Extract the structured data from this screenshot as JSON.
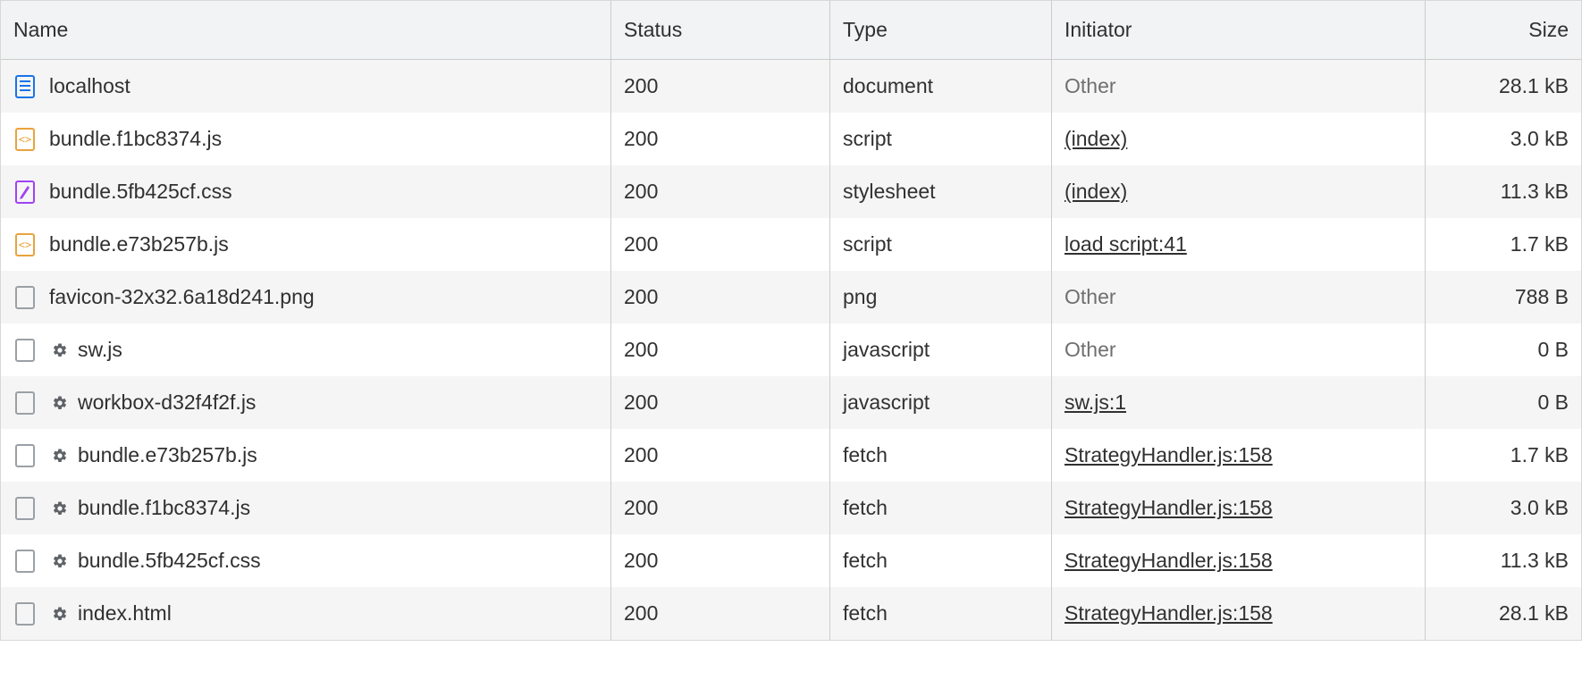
{
  "headers": {
    "name": "Name",
    "status": "Status",
    "type": "Type",
    "initiator": "Initiator",
    "size": "Size"
  },
  "rows": [
    {
      "icon": "document",
      "gear": false,
      "name": "localhost",
      "status": "200",
      "type": "document",
      "initiator": "Other",
      "initiator_link": false,
      "size": "28.1 kB"
    },
    {
      "icon": "script",
      "gear": false,
      "name": "bundle.f1bc8374.js",
      "status": "200",
      "type": "script",
      "initiator": "(index)",
      "initiator_link": true,
      "size": "3.0 kB"
    },
    {
      "icon": "stylesheet",
      "gear": false,
      "name": "bundle.5fb425cf.css",
      "status": "200",
      "type": "stylesheet",
      "initiator": "(index)",
      "initiator_link": true,
      "size": "11.3 kB"
    },
    {
      "icon": "script",
      "gear": false,
      "name": "bundle.e73b257b.js",
      "status": "200",
      "type": "script",
      "initiator": "load script:41",
      "initiator_link": true,
      "size": "1.7 kB"
    },
    {
      "icon": "file",
      "gear": false,
      "name": "favicon-32x32.6a18d241.png",
      "status": "200",
      "type": "png",
      "initiator": "Other",
      "initiator_link": false,
      "size": "788 B"
    },
    {
      "icon": "file",
      "gear": true,
      "name": "sw.js",
      "status": "200",
      "type": "javascript",
      "initiator": "Other",
      "initiator_link": false,
      "size": "0 B"
    },
    {
      "icon": "file",
      "gear": true,
      "name": "workbox-d32f4f2f.js",
      "status": "200",
      "type": "javascript",
      "initiator": "sw.js:1",
      "initiator_link": true,
      "size": "0 B"
    },
    {
      "icon": "file",
      "gear": true,
      "name": "bundle.e73b257b.js",
      "status": "200",
      "type": "fetch",
      "initiator": "StrategyHandler.js:158",
      "initiator_link": true,
      "size": "1.7 kB"
    },
    {
      "icon": "file",
      "gear": true,
      "name": "bundle.f1bc8374.js",
      "status": "200",
      "type": "fetch",
      "initiator": "StrategyHandler.js:158",
      "initiator_link": true,
      "size": "3.0 kB"
    },
    {
      "icon": "file",
      "gear": true,
      "name": "bundle.5fb425cf.css",
      "status": "200",
      "type": "fetch",
      "initiator": "StrategyHandler.js:158",
      "initiator_link": true,
      "size": "11.3 kB"
    },
    {
      "icon": "file",
      "gear": true,
      "name": "index.html",
      "status": "200",
      "type": "fetch",
      "initiator": "StrategyHandler.js:158",
      "initiator_link": true,
      "size": "28.1 kB"
    }
  ]
}
